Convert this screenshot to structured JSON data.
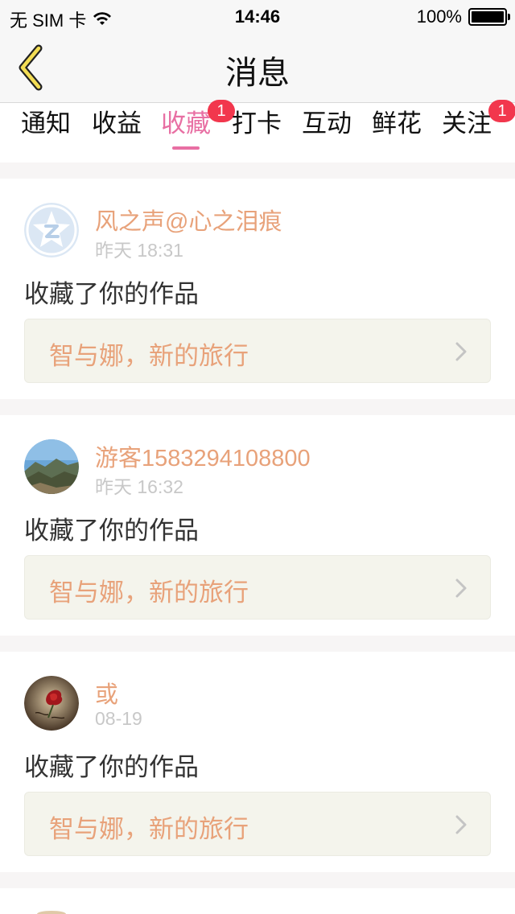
{
  "status_bar": {
    "carrier": "无 SIM 卡",
    "time": "14:46",
    "battery": "100%",
    "battery_level": 1.0
  },
  "nav": {
    "title": "消息",
    "back_icon": "chevron-left-icon"
  },
  "tabs": [
    {
      "label": "通知"
    },
    {
      "label": "收益"
    },
    {
      "label": "收藏",
      "active": true,
      "badge": "1"
    },
    {
      "label": "打卡"
    },
    {
      "label": "互动"
    },
    {
      "label": "鲜花"
    },
    {
      "label": "关注",
      "badge": "1"
    }
  ],
  "messages": [
    {
      "username": "风之声@心之泪痕",
      "time": "昨天 18:31",
      "action": "收藏了你的作品",
      "work_title": "智与娜，新的旅行",
      "avatar": "default-qq-avatar-icon"
    },
    {
      "username": "游客1583294108800",
      "time": "昨天 16:32",
      "action": "收藏了你的作品",
      "work_title": "智与娜，新的旅行",
      "avatar": "mountain-landscape-avatar"
    },
    {
      "username": "或",
      "time": "08-19",
      "action": "收藏了你的作品",
      "work_title": "智与娜，新的旅行",
      "avatar": "rose-avatar"
    }
  ],
  "colors": {
    "accent": "#e86fa3",
    "name": "#e8a27a",
    "badge": "#f2374d",
    "link_bg": "#f4f4ec"
  }
}
